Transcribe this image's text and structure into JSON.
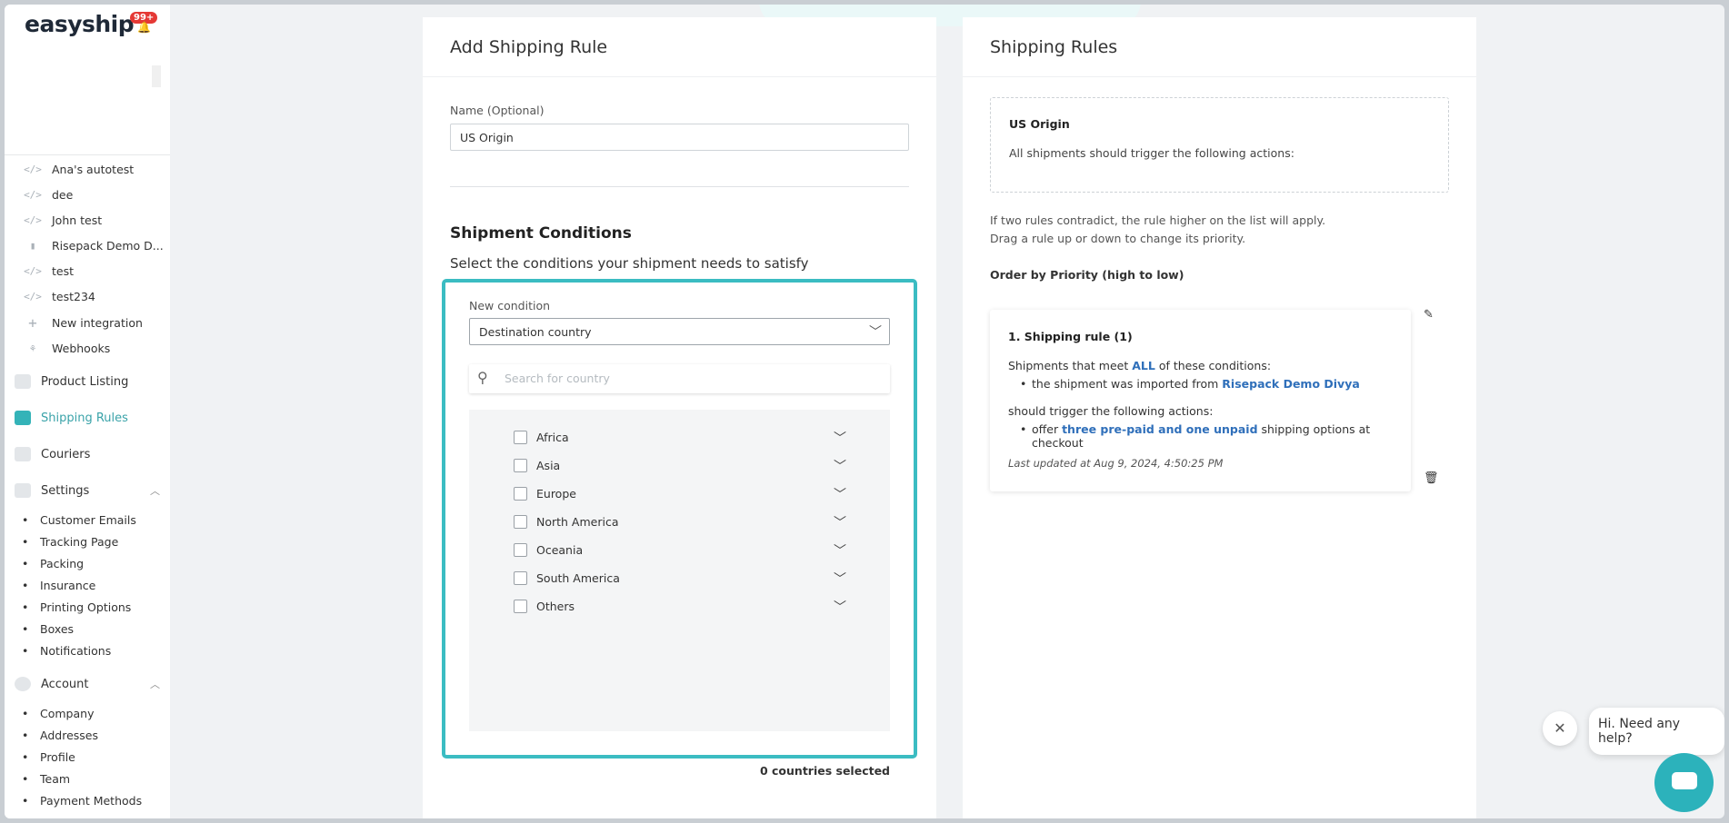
{
  "app": {
    "logo": "easyship",
    "notification_badge": "99+"
  },
  "sidebar": {
    "integrations": [
      {
        "icon": "code-icon",
        "label": "Ana's autotest"
      },
      {
        "icon": "code-icon",
        "label": "dee"
      },
      {
        "icon": "code-icon",
        "label": "John test"
      },
      {
        "icon": "bag-icon",
        "label": "Risepack Demo D..."
      },
      {
        "icon": "code-icon",
        "label": "test"
      },
      {
        "icon": "code-icon",
        "label": "test234"
      },
      {
        "icon": "plus-icon",
        "label": "New integration"
      },
      {
        "icon": "webhooks-icon",
        "label": "Webhooks"
      }
    ],
    "nav": {
      "product_listing": "Product Listing",
      "shipping_rules": "Shipping Rules",
      "couriers": "Couriers",
      "settings": "Settings",
      "account": "Account"
    },
    "settings_items": [
      "Customer Emails",
      "Tracking Page",
      "Packing",
      "Insurance",
      "Printing Options",
      "Boxes",
      "Notifications"
    ],
    "account_items": [
      "Company",
      "Addresses",
      "Profile",
      "Team",
      "Payment Methods"
    ]
  },
  "add_rule": {
    "title": "Add Shipping Rule",
    "name_label": "Name (Optional)",
    "name_value": "US Origin",
    "conditions_heading": "Shipment Conditions",
    "conditions_desc": "Select the conditions your shipment needs to satisfy",
    "new_condition_label": "New condition",
    "condition_selected": "Destination country",
    "search_placeholder": "Search for country",
    "regions": [
      "Africa",
      "Asia",
      "Europe",
      "North America",
      "Oceania",
      "South America",
      "Others"
    ],
    "selected_count": "0 countries selected"
  },
  "rules_panel": {
    "title": "Shipping Rules",
    "preview_name": "US Origin",
    "preview_text": "All shipments should trigger the following actions:",
    "note_line1": "If two rules contradict, the rule higher on the list will apply.",
    "note_line2": "Drag a rule up or down to change its priority.",
    "order_label": "Order by Priority (high to low)",
    "rule": {
      "title": "1. Shipping rule (1)",
      "cond_pre": "Shipments that meet ",
      "cond_all": "ALL",
      "cond_post": " of these conditions:",
      "cond_item_pre": "the shipment was imported from ",
      "cond_item_store": "Risepack Demo Divya",
      "action_intro": "should trigger the following actions:",
      "action_pre": "offer ",
      "action_highlight": "three pre-paid and one unpaid",
      "action_post": " shipping options at checkout",
      "updated": "Last updated at Aug 9, 2024, 4:50:25 PM"
    }
  },
  "help": {
    "text": "Hi. Need any help?"
  },
  "colors": {
    "accent": "#3bbcc2",
    "link": "#2f6fba",
    "badge": "#e53935"
  }
}
